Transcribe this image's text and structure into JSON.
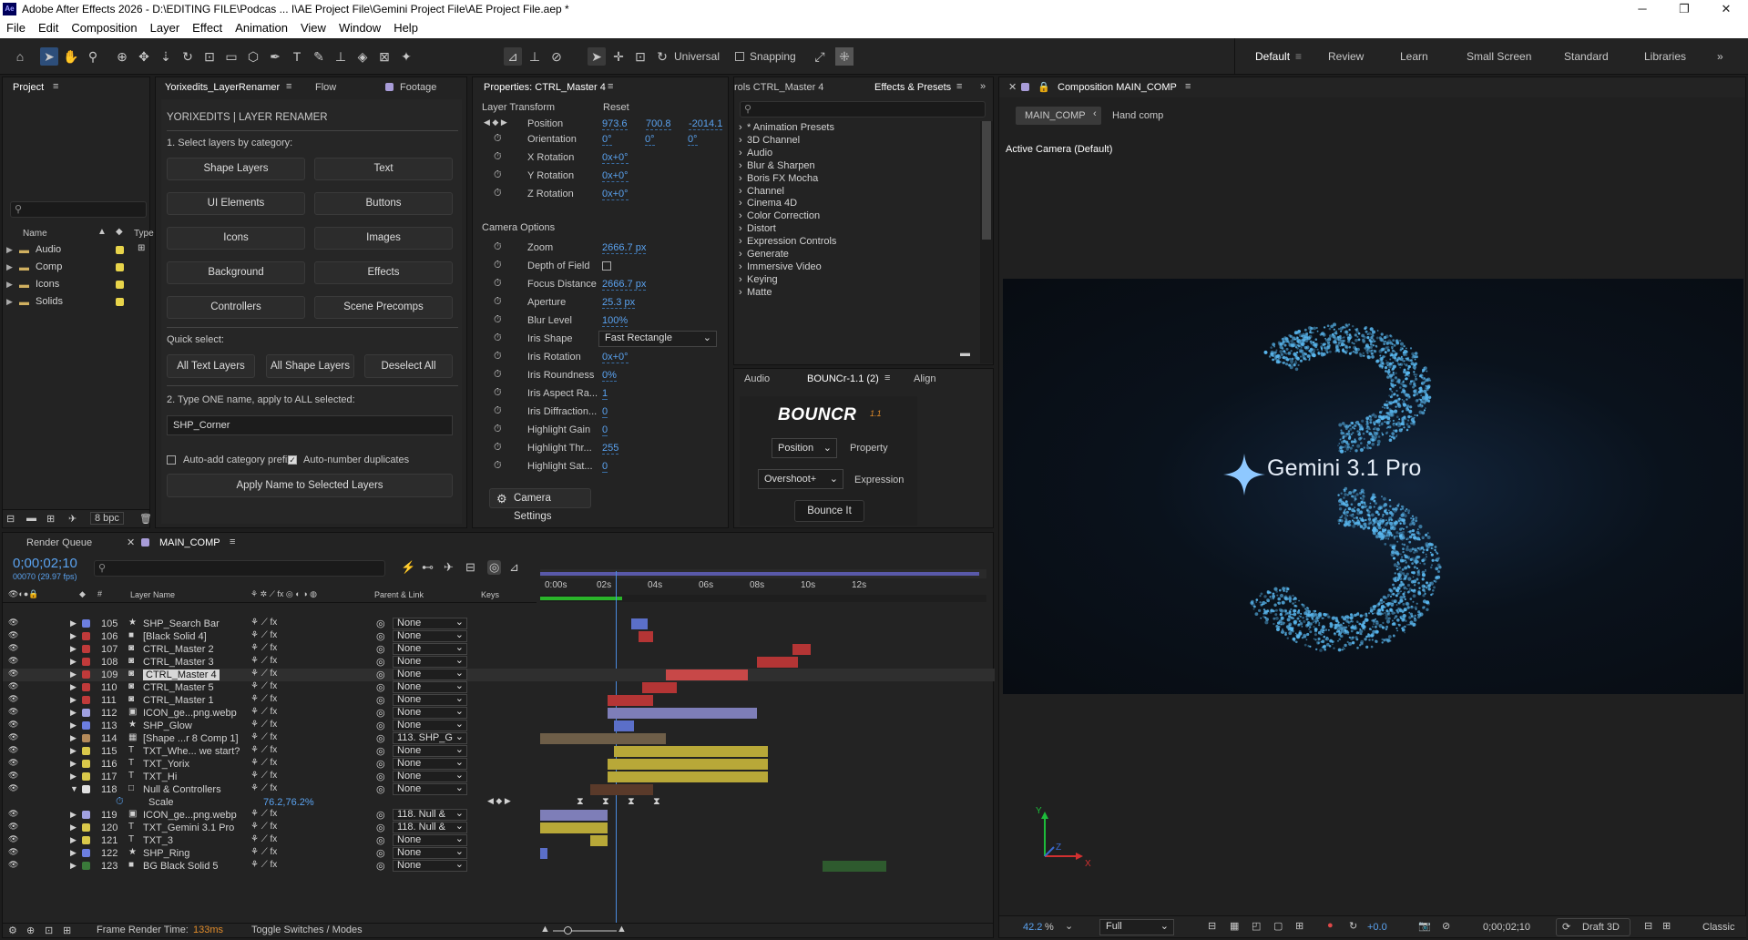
{
  "window": {
    "title": "Adobe After Effects 2026 - D:\\EDITING FILE\\Podcas ... I\\AE Project File\\Gemini Project File\\AE Project File.aep *",
    "logo": "Ae"
  },
  "menu": [
    "File",
    "Edit",
    "Composition",
    "Layer",
    "Effect",
    "Animation",
    "View",
    "Window",
    "Help"
  ],
  "toolbar": {
    "universal": "Universal",
    "snapping": "Snapping"
  },
  "workspaces": [
    "Default",
    "Review",
    "Learn",
    "Small Screen",
    "Standard",
    "Libraries"
  ],
  "project": {
    "title": "Project",
    "search_placeholder": "",
    "col_name": "Name",
    "col_type": "Type",
    "folders": [
      "Audio",
      "Comp",
      "Icons",
      "Solids"
    ],
    "bpc": "8 bpc"
  },
  "renamer": {
    "tabs": [
      "Yorixedits_LayerRenamer",
      "Flow",
      "Footage"
    ],
    "header": "YORIXEDITS | LAYER RENAMER",
    "step1": "1. Select layers by category:",
    "categories": [
      "Shape Layers",
      "Text",
      "UI Elements",
      "Buttons",
      "Icons",
      "Images",
      "Background",
      "Effects",
      "Controllers",
      "Scene Precomps"
    ],
    "quick": "Quick select:",
    "quick_buttons": [
      "All Text Layers",
      "All Shape Layers",
      "Deselect All"
    ],
    "step2": "2. Type ONE name, apply to ALL selected:",
    "name_value": "SHP_Corner",
    "auto_prefix": "Auto-add category prefix",
    "auto_number": "Auto-number duplicates",
    "apply": "Apply Name to Selected Layers"
  },
  "properties": {
    "title": "Properties: CTRL_Master 4",
    "section1": "Layer Transform",
    "reset": "Reset",
    "position_label": "Position",
    "position": [
      "973.6",
      "700.8",
      "-2014.1"
    ],
    "orientation_label": "Orientation",
    "orientation": [
      "0°",
      "0°",
      "0°"
    ],
    "xrot_label": "X Rotation",
    "xrot": "0x+0°",
    "yrot_label": "Y Rotation",
    "yrot": "0x+0°",
    "zrot_label": "Z Rotation",
    "zrot": "0x+0°",
    "section2": "Camera Options",
    "zoom_label": "Zoom",
    "zoom": "2666.7 px",
    "dof_label": "Depth of Field",
    "focus_label": "Focus Distance",
    "focus": "2666.7 px",
    "aperture_label": "Aperture",
    "aperture": "25.3 px",
    "blur_label": "Blur Level",
    "blur": "100%",
    "iris_label": "Iris Shape",
    "iris": "Fast Rectangle",
    "irisrot_label": "Iris Rotation",
    "irisrot": "0x+0°",
    "irisround_label": "Iris Roundness",
    "irisround": "0%",
    "irisaspect_label": "Iris Aspect Ra...",
    "irisaspect": "1",
    "irisdiff_label": "Iris Diffraction...",
    "irisdiff": "0",
    "hgain_label": "Highlight Gain",
    "hgain": "0",
    "hthr_label": "Highlight Thr...",
    "hthr": "255",
    "hsat_label": "Highlight Sat...",
    "hsat": "0",
    "camera_settings": "Camera Settings"
  },
  "effects": {
    "tab_left": "rols CTRL_Master 4",
    "tab": "Effects & Presets",
    "items": [
      "* Animation Presets",
      "3D Channel",
      "Audio",
      "Blur & Sharpen",
      "Boris FX Mocha",
      "Channel",
      "Cinema 4D",
      "Color Correction",
      "Distort",
      "Expression Controls",
      "Generate",
      "Immersive Video",
      "Keying",
      "Matte"
    ]
  },
  "bouncr": {
    "tabs": [
      "Audio",
      "BOUNCr-1.1 (2)",
      "Align"
    ],
    "logo": "BOUNCR",
    "version": "1.1",
    "property_value": "Position",
    "property_label": "Property",
    "expression_value": "Overshoot+",
    "expression_label": "Expression",
    "button": "Bounce It"
  },
  "composition": {
    "title": "Composition MAIN_COMP",
    "crumb1": "MAIN_COMP",
    "crumb2": "Hand comp",
    "camera": "Active Camera (Default)",
    "viewer_text": "Gemini 3.1 Pro",
    "zoom": "42.2",
    "zoom_unit": "%",
    "quality": "Full",
    "exposure": "+0.0",
    "timecode": "0;00;02;10",
    "renderer": "Draft 3D",
    "classic": "Classic"
  },
  "timeline": {
    "tabs": [
      "Render Queue",
      "MAIN_COMP"
    ],
    "timecode": "0;00;02;10",
    "frames": "00070 (29.97 fps)",
    "col_layer": "Layer Name",
    "col_parent": "Parent & Link",
    "col_keys": "Keys",
    "ruler": [
      "0:00s",
      "02s",
      "04s",
      "06s",
      "08s",
      "10s",
      "12s"
    ],
    "frame_render": "Frame Render Time:",
    "frame_render_value": "133ms",
    "toggle": "Toggle Switches / Modes",
    "scale_label": "Scale",
    "scale_value": "76.2,76.2%",
    "layers": [
      {
        "num": "105",
        "name": "SHP_Search Bar",
        "parent": "None",
        "color": "#6c7ee0",
        "icon": "★"
      },
      {
        "num": "106",
        "name": "[Black Solid 4]",
        "parent": "None",
        "color": "#c03a3a",
        "icon": "■"
      },
      {
        "num": "107",
        "name": "CTRL_Master 2",
        "parent": "None",
        "color": "#c03a3a",
        "icon": "◙"
      },
      {
        "num": "108",
        "name": "CTRL_Master 3",
        "parent": "None",
        "color": "#c03a3a",
        "icon": "◙"
      },
      {
        "num": "109",
        "name": "CTRL_Master 4",
        "parent": "None",
        "color": "#c03a3a",
        "icon": "◙"
      },
      {
        "num": "110",
        "name": "CTRL_Master 5",
        "parent": "None",
        "color": "#c03a3a",
        "icon": "◙"
      },
      {
        "num": "111",
        "name": "CTRL_Master 1",
        "parent": "None",
        "color": "#c03a3a",
        "icon": "◙"
      },
      {
        "num": "112",
        "name": "ICON_ge...png.webp",
        "parent": "None",
        "color": "#a0a0e0",
        "icon": "▣"
      },
      {
        "num": "113",
        "name": "SHP_Glow",
        "parent": "None",
        "color": "#6c7ee0",
        "icon": "★"
      },
      {
        "num": "114",
        "name": "[Shape ...r 8 Comp 1]",
        "parent": "113. SHP_G",
        "color": "#b48a5a",
        "icon": "▦"
      },
      {
        "num": "115",
        "name": "TXT_Whe... we start?",
        "parent": "None",
        "color": "#d9c84a",
        "icon": "T"
      },
      {
        "num": "116",
        "name": "TXT_Yorix",
        "parent": "None",
        "color": "#d9c84a",
        "icon": "T"
      },
      {
        "num": "117",
        "name": "TXT_Hi",
        "parent": "None",
        "color": "#d9c84a",
        "icon": "T"
      },
      {
        "num": "118",
        "name": "Null & Controllers",
        "parent": "None",
        "color": "#e0e0e0",
        "icon": "□"
      },
      {
        "num": "119",
        "name": "ICON_ge...png.webp",
        "parent": "118. Null &",
        "color": "#a0a0e0",
        "icon": "▣"
      },
      {
        "num": "120",
        "name": "TXT_Gemini 3.1 Pro",
        "parent": "118. Null &",
        "color": "#d9c84a",
        "icon": "T"
      },
      {
        "num": "121",
        "name": "TXT_3",
        "parent": "None",
        "color": "#d9c84a",
        "icon": "T"
      },
      {
        "num": "122",
        "name": "SHP_Ring",
        "parent": "None",
        "color": "#6c7ee0",
        "icon": "★"
      },
      {
        "num": "123",
        "name": "BG Black Solid 5",
        "parent": "None",
        "color": "#3a7a3a",
        "icon": "■"
      }
    ]
  }
}
